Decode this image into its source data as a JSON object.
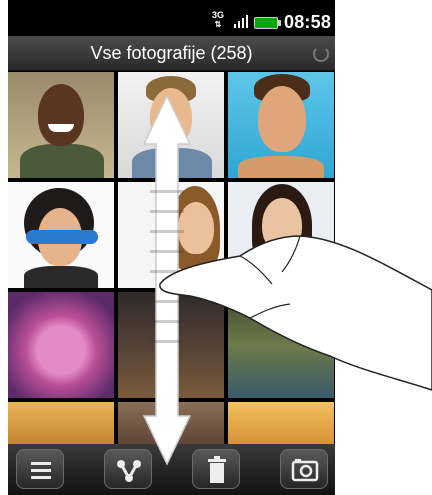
{
  "status": {
    "network": "3G",
    "time": "08:58"
  },
  "header": {
    "title": "Vse fotografije (258)"
  },
  "thumbnails": [
    "photo-1",
    "photo-2",
    "photo-3",
    "photo-4",
    "photo-5",
    "photo-6",
    "photo-7",
    "photo-8",
    "photo-9",
    "photo-10",
    "photo-11",
    "photo-12"
  ],
  "toolbar": {
    "icons": [
      "menu-icon",
      "share-icon",
      "trash-icon",
      "camera-icon"
    ]
  },
  "colors": {
    "battery": "#00aa00",
    "titlebar": "#3a3a3a"
  }
}
